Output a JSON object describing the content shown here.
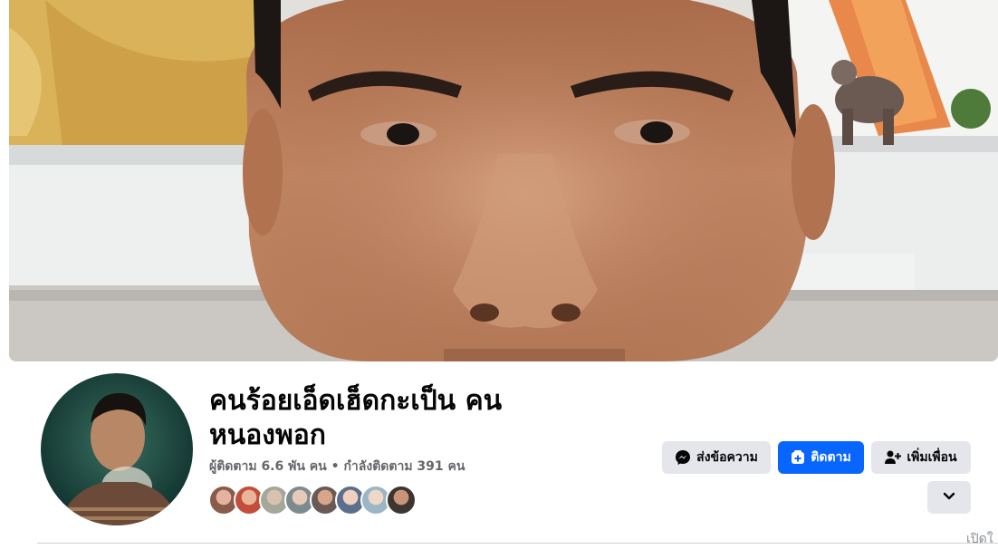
{
  "profile": {
    "name": "คนร้อยเอ็ดเฮ็ดกะเป็น คน หนองพอก",
    "followers": "ผู้ติดตาม 6.6 พัน คน",
    "separator": "•",
    "following": "กำลังติดตาม 391 คน",
    "stats_line": "ผู้ติดตาม 6.6 พัน คน • กำลังติดตาม 391 คน"
  },
  "actions": {
    "message_label": "ส่งข้อความ",
    "follow_label": "ติดตาม",
    "add_friend_label": "เพิ่มเพื่อน"
  },
  "footer": {
    "cut_text": "เปิดใ"
  },
  "icons": {
    "message": "messenger-icon",
    "follow": "follow-plus-icon",
    "add_friend": "add-friend-icon",
    "more": "chevron-down-icon"
  },
  "colors": {
    "primary": "#0866ff",
    "secondary_button": "#e4e6eb",
    "text_primary": "#050505",
    "text_secondary": "#65676b"
  }
}
